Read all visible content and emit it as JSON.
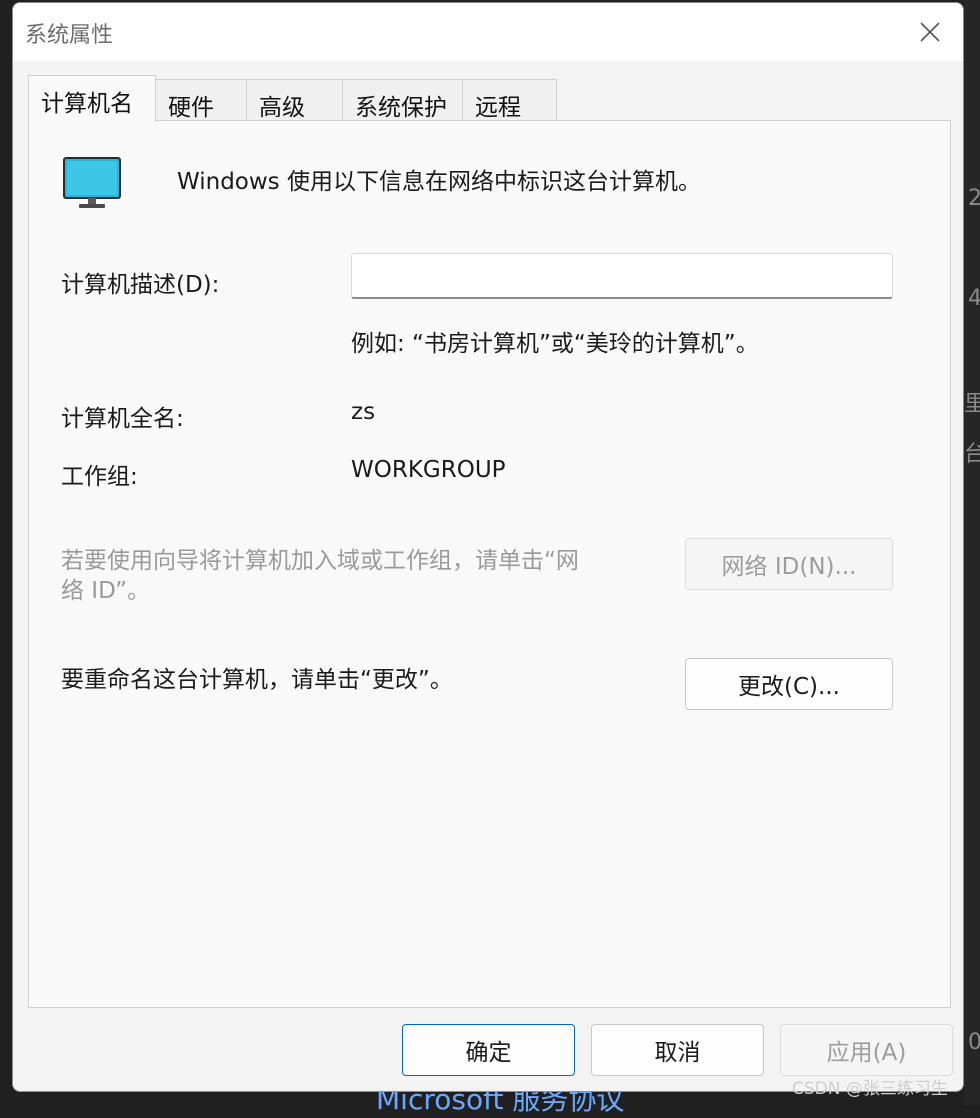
{
  "window": {
    "title": "系统属性"
  },
  "tabs": [
    {
      "label": "计算机名",
      "active": true
    },
    {
      "label": "硬件"
    },
    {
      "label": "高级"
    },
    {
      "label": "系统保护"
    },
    {
      "label": "远程"
    }
  ],
  "panel": {
    "intro": "Windows 使用以下信息在网络中标识这台计算机。",
    "description_label": "计算机描述(D):",
    "description_value": "",
    "example_text": "例如: “书房计算机”或“美玲的计算机”。",
    "full_name_label": "计算机全名:",
    "full_name_value": "zs",
    "workgroup_label": "工作组:",
    "workgroup_value": "WORKGROUP",
    "domain_hint_line1": "若要使用向导将计算机加入域或工作组，请单击“网",
    "domain_hint_line2": "络 ID”。",
    "network_id_button": "网络 ID(N)...",
    "rename_hint": "要重命名这台计算机，请单击“更改”。",
    "change_button": "更改(C)..."
  },
  "footer": {
    "ok_button": "确定",
    "cancel_button": "取消",
    "apply_button": "应用(A)"
  },
  "background": {
    "link_text": "Microsoft 服务协议",
    "watermark": "CSDN @张三练习生",
    "edge_chars": [
      "2",
      "4",
      "里",
      "台",
      "0"
    ]
  },
  "colors": {
    "accent": "#0067c0",
    "monitor_screen": "#2ab4d8"
  },
  "icons": [
    "close-icon",
    "computer-monitor-icon"
  ]
}
